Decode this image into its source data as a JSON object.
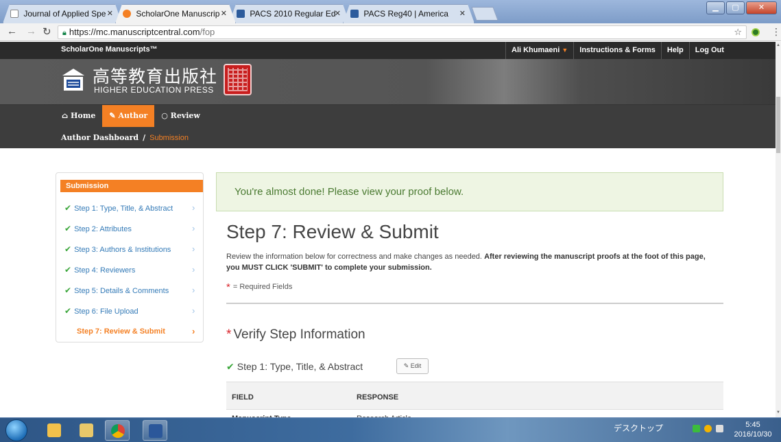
{
  "browser": {
    "tabs": [
      {
        "title": "Journal of Applied Spe",
        "active": false
      },
      {
        "title": "ScholarOne Manuscrip",
        "active": true
      },
      {
        "title": "PACS 2010 Regular Ed",
        "active": false
      },
      {
        "title": "PACS Reg40 | America",
        "active": false
      }
    ],
    "url_host": "https://mc.manuscriptcentral.com",
    "url_path": "/fop"
  },
  "site": {
    "product_name": "ScholarOne Manuscripts™",
    "user_name": "Ali Khumaeni",
    "links": [
      "Instructions & Forms",
      "Help",
      "Log Out"
    ],
    "publisher_cjk": "高等教育出版社",
    "publisher_en": "HIGHER EDUCATION PRESS"
  },
  "nav": {
    "tabs": [
      {
        "label": "Home",
        "icon": "home-icon"
      },
      {
        "label": "Author",
        "icon": "pencil-icon"
      },
      {
        "label": "Review",
        "icon": "comment-icon"
      }
    ],
    "breadcrumb_root": "Author Dashboard",
    "breadcrumb_sep": "/",
    "breadcrumb_current": "Submission"
  },
  "sidebar": {
    "heading": "Submission",
    "items": [
      {
        "label": "Step 1: Type, Title, & Abstract",
        "done": true
      },
      {
        "label": "Step 2: Attributes",
        "done": true
      },
      {
        "label": "Step 3: Authors & Institutions",
        "done": true
      },
      {
        "label": "Step 4: Reviewers",
        "done": true
      },
      {
        "label": "Step 5: Details & Comments",
        "done": true
      },
      {
        "label": "Step 6: File Upload",
        "done": true
      },
      {
        "label": "Step 7: Review & Submit",
        "done": false
      }
    ]
  },
  "main": {
    "alert": "You're almost done! Please view your proof below.",
    "title": "Step 7: Review & Submit",
    "intro_plain": "Review the information below for correctness and make changes as needed.",
    "intro_bold": "After reviewing the manuscript proofs at the foot of this page, you MUST CLICK 'SUBMIT' to complete your submission.",
    "required_legend": "= Required Fields",
    "verify_heading": "Verify Step Information",
    "step1_heading": "Step 1: Type, Title, & Abstract",
    "edit_label": "Edit",
    "table_headers": [
      "FIELD",
      "RESPONSE"
    ],
    "table_rows": [
      [
        "Manuscript Type",
        "Research Article"
      ]
    ]
  },
  "taskbar": {
    "tray_label": "デスクトップ",
    "time": "5:45",
    "date": "2016/10/30"
  },
  "colors": {
    "accent": "#f48024",
    "success": "#3aa63a",
    "link": "#337ab7",
    "alert_bg": "#eef5e3"
  }
}
